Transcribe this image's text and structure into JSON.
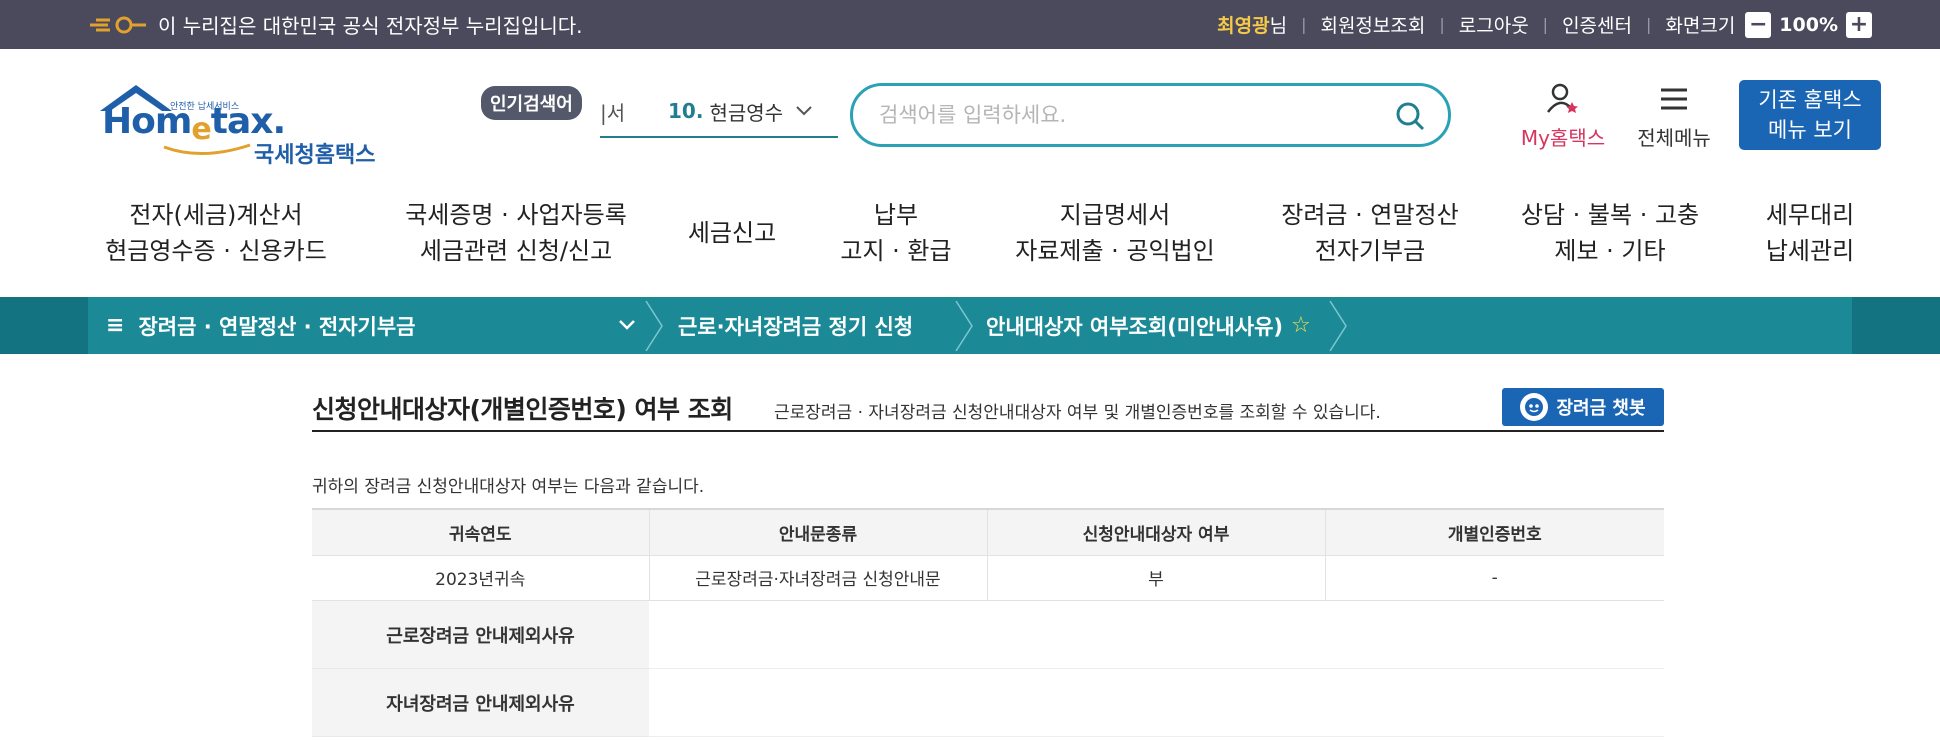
{
  "gov_bar": {
    "notice": "이 누리집은 대한민국 공식 전자정부 누리집입니다.",
    "user_name": "최영광",
    "user_suffix": "님",
    "links": [
      "회원정보조회",
      "로그아웃",
      "인증센터",
      "화면크기"
    ],
    "zoom_minus": "−",
    "zoom_value": "100%",
    "zoom_plus": "+"
  },
  "header": {
    "logo_small": "안전한 납세서비스",
    "logo_home": "Hom",
    "logo_e": "e",
    "logo_tax": "tax.",
    "logo_kr": "국세청홈택스",
    "popular_badge": "인기검색어",
    "keyword_prev": "|서",
    "keyword_num": "10.",
    "keyword_text": "현금영수",
    "search_placeholder": "검색어를 입력하세요.",
    "mytax_label": "My홈택스",
    "allmenu_label": "전체메뉴",
    "old_menu_line1": "기존 홈택스",
    "old_menu_line2": "메뉴 보기"
  },
  "gnb": [
    {
      "line1": "전자(세금)계산서",
      "line2": "현금영수증 · 신용카드"
    },
    {
      "line1": "국세증명 · 사업자등록",
      "line2": "세금관련 신청/신고"
    },
    {
      "line1": "세금신고",
      "line2": ""
    },
    {
      "line1": "납부",
      "line2": "고지 · 환급"
    },
    {
      "line1": "지급명세서",
      "line2": "자료제출 · 공익법인"
    },
    {
      "line1": "장려금 · 연말정산",
      "line2": "전자기부금"
    },
    {
      "line1": "상담 · 불복 · 고충",
      "line2": "제보 · 기타"
    },
    {
      "line1": "세무대리",
      "line2": "납세관리"
    }
  ],
  "location": {
    "menu_icon": "≡",
    "level1": "장려금 · 연말정산 · 전자기부금",
    "level2": "근로·자녀장려금 정기 신청",
    "level3": "안내대상자 여부조회(미안내사유)",
    "star": "☆"
  },
  "content": {
    "title": "신청안내대상자(개별인증번호) 여부 조회",
    "description": "근로장려금 · 자녀장려금 신청안내대상자 여부 및 개별인증번호를 조회할 수 있습니다.",
    "chatbot_label": "장려금 챗봇",
    "intro": "귀하의 장려금 신청안내대상자 여부는 다음과 같습니다.",
    "table": {
      "headers": [
        "귀속연도",
        "안내문종류",
        "신청안내대상자 여부",
        "개별인증번호"
      ],
      "rows": [
        [
          "2023년귀속",
          "근로장려금·자녀장려금 신청안내문",
          "부",
          "-"
        ]
      ]
    },
    "reason1_label": "근로장려금 안내제외사유",
    "reason2_label": "자녀장려금 안내제외사유"
  },
  "colors": {
    "gov_bar": "#4a4a5c",
    "location_bar": "#1b8a96",
    "brand_blue": "#1a66b5",
    "accent_red": "#d6365e"
  }
}
